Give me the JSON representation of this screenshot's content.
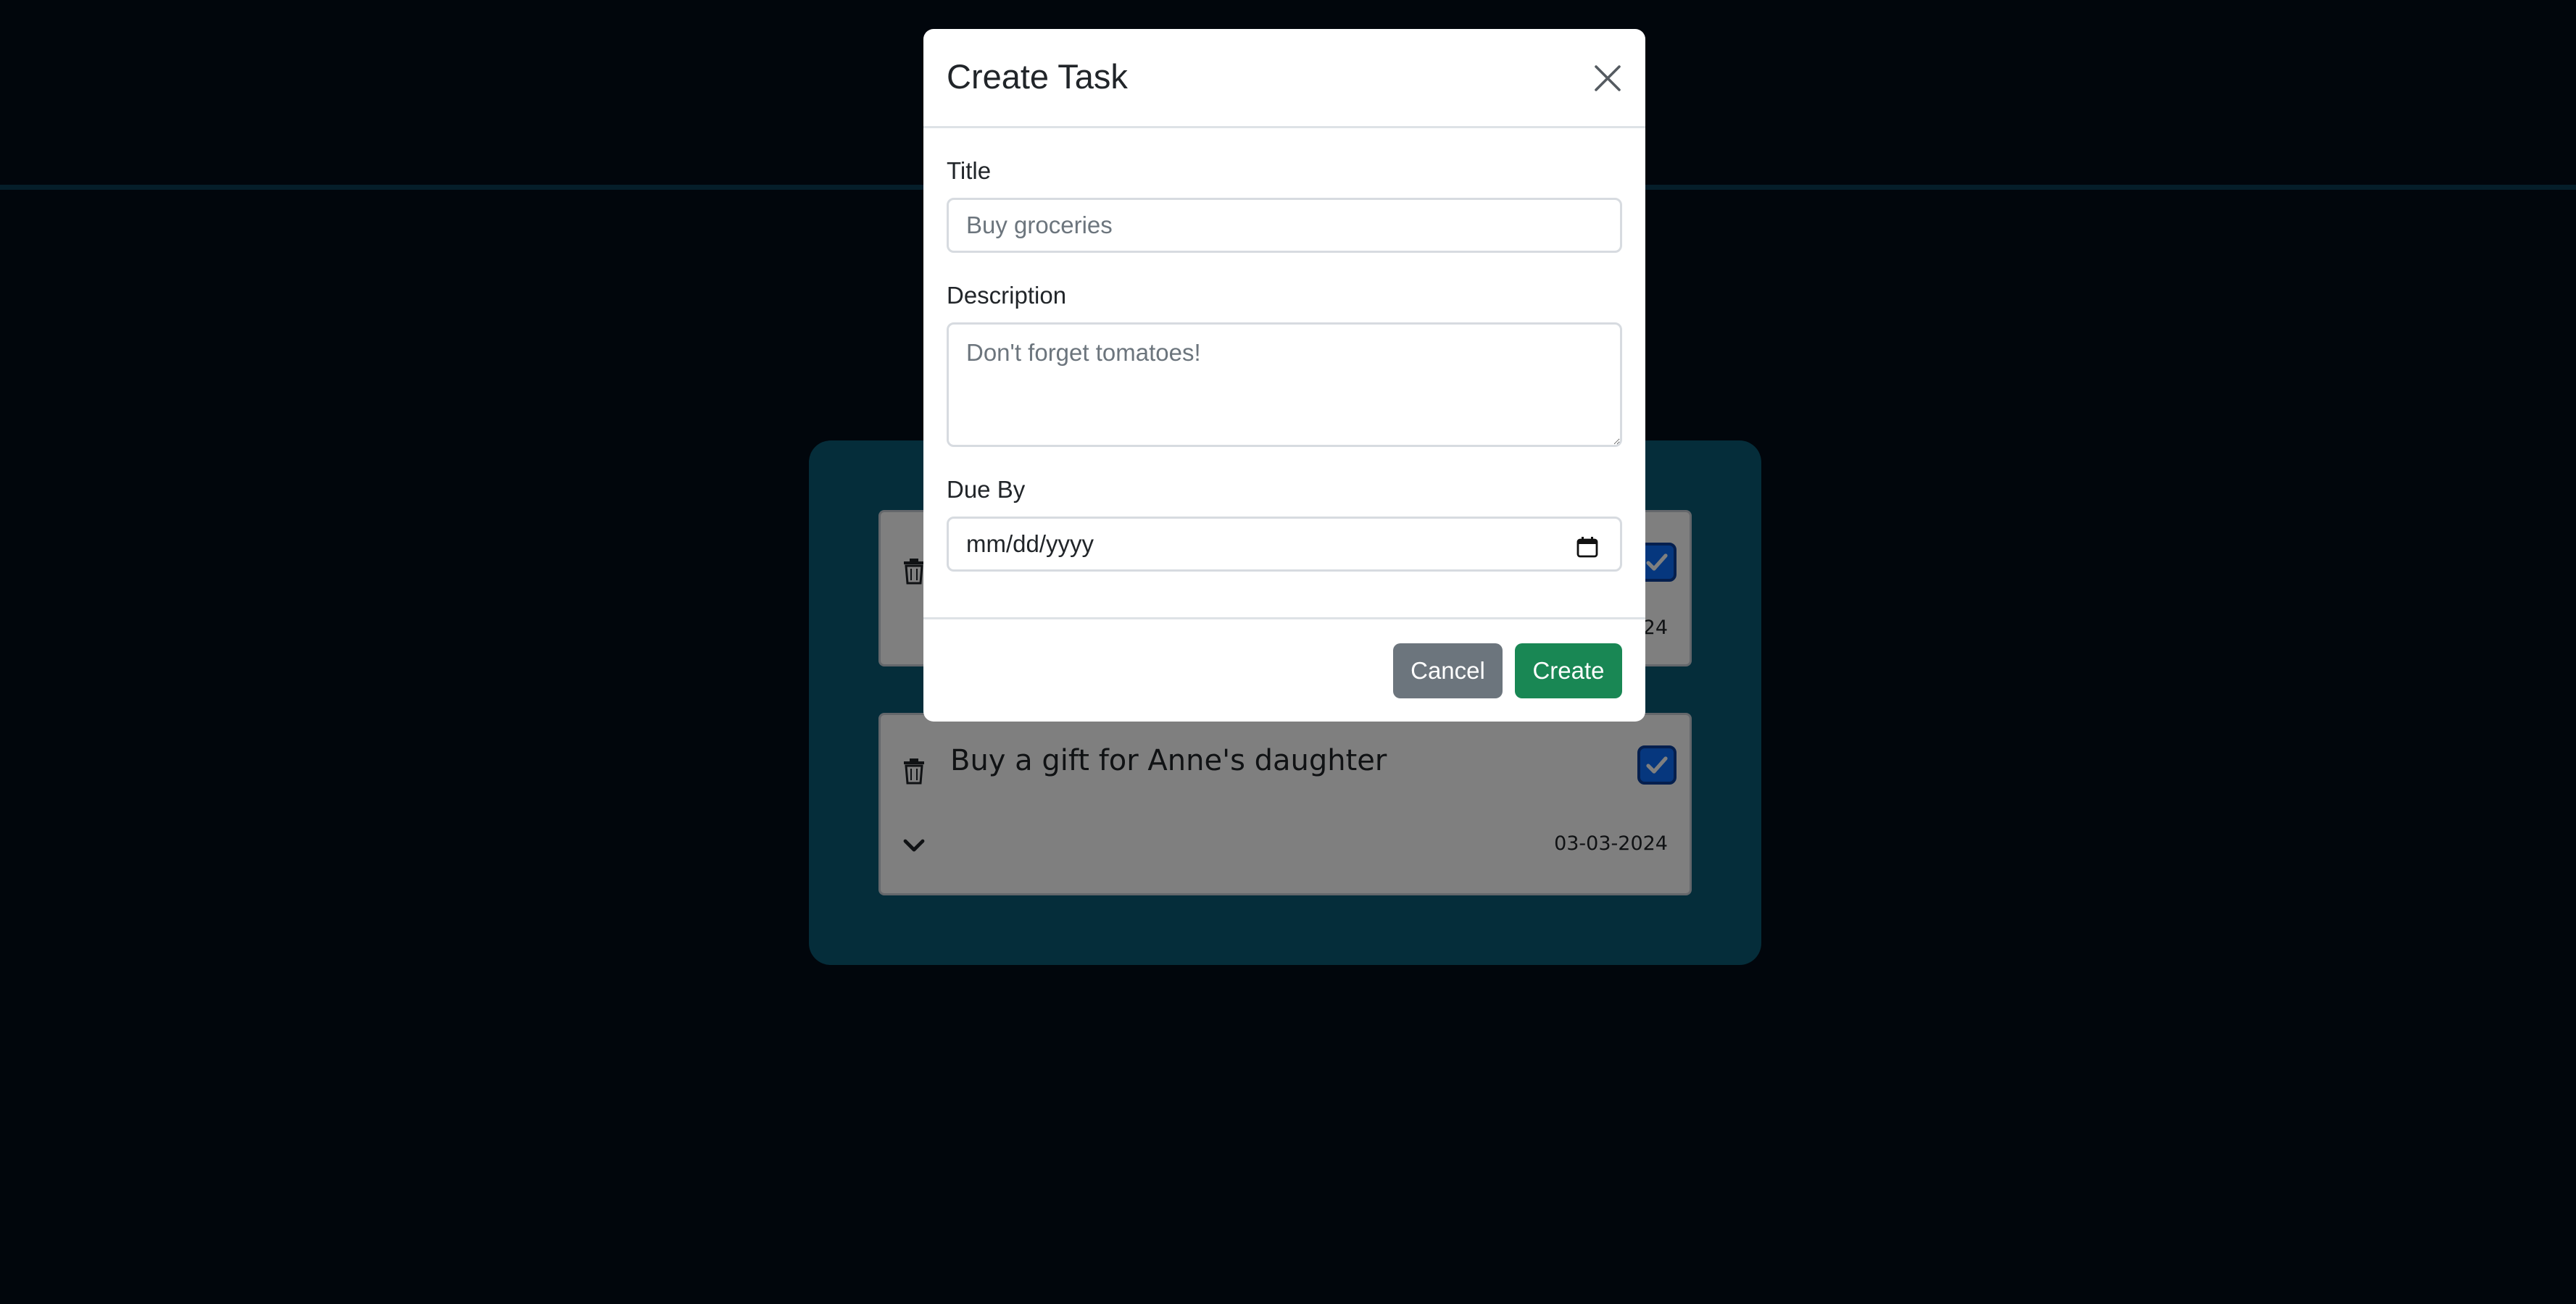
{
  "tasks": [
    {
      "title": "",
      "date": "24",
      "completed": true
    },
    {
      "title": "Buy a gift for Anne's daughter",
      "date": "03-03-2024",
      "completed": true
    }
  ],
  "modal": {
    "title": "Create Task",
    "fields": {
      "title_label": "Title",
      "title_placeholder": "Buy groceries",
      "description_label": "Description",
      "description_placeholder": "Don't forget tomatoes!",
      "due_label": "Due By",
      "due_placeholder": "mm/dd/yyyy"
    },
    "buttons": {
      "cancel": "Cancel",
      "create": "Create"
    }
  },
  "colors": {
    "page_background": "#020c19",
    "board_background": "#0b5a74",
    "checkbox_blue": "#0d6efd",
    "cancel_gray": "#6c757d",
    "create_green": "#198754"
  },
  "icons": {
    "delete": "trash-icon",
    "expand": "chevron-down-icon",
    "check": "checkmark-icon",
    "close": "close-icon",
    "calendar": "calendar-icon"
  }
}
